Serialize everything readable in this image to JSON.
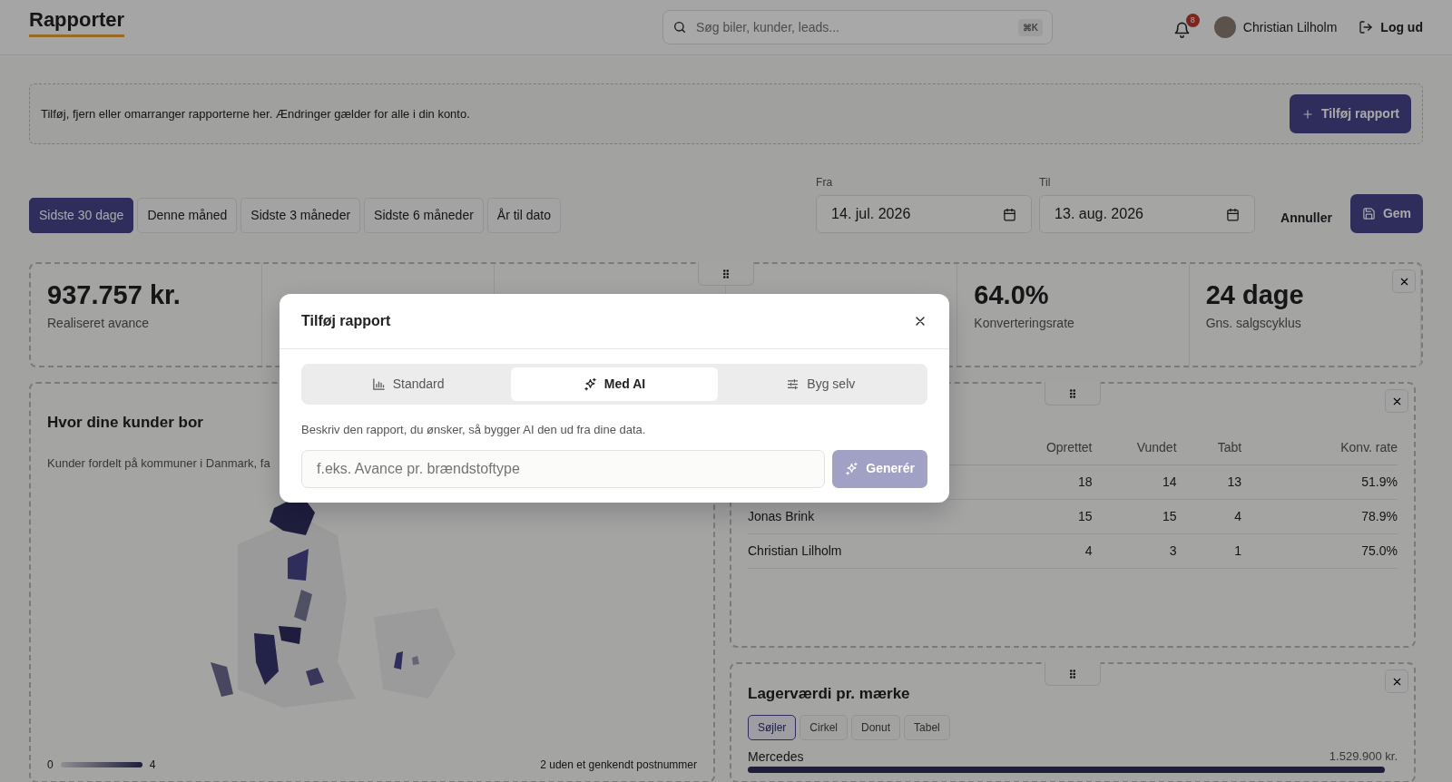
{
  "header": {
    "title": "Rapporter",
    "search": {
      "placeholder": "Søg biler, kunder, leads...",
      "shortcut": "⌘K"
    },
    "notifications": {
      "count": "8"
    },
    "user": {
      "name": "Christian Lilholm"
    },
    "logout": "Log ud"
  },
  "info_bar": {
    "text": "Tilføj, fjern eller omarranger rapporterne her. Ændringer gælder for alle i din konto.",
    "button": "Tilføj rapport"
  },
  "periods": [
    {
      "label": "Sidste 30 dage",
      "selected": true
    },
    {
      "label": "Denne måned",
      "selected": false
    },
    {
      "label": "Sidste 3 måneder",
      "selected": false
    },
    {
      "label": "Sidste 6 måneder",
      "selected": false
    },
    {
      "label": "År til dato",
      "selected": false
    }
  ],
  "date_range": {
    "from": {
      "label": "Fra",
      "value": "14. jul. 2026"
    },
    "to": {
      "label": "Til",
      "value": "13. aug. 2026"
    }
  },
  "actions": {
    "cancel": "Annuller",
    "save": "Gem"
  },
  "kpis": [
    {
      "value": "937.757 kr.",
      "label": "Realiseret avance"
    },
    {
      "value": "64.0%",
      "label": "Konverteringsrate"
    },
    {
      "value": "24 dage",
      "label": "Gns. salgscyklus"
    }
  ],
  "map_panel": {
    "title": "Hvor dine kunder bor",
    "subtitle": "Kunder fordelt på kommuner i Danmark, fa",
    "legend_min": "0",
    "legend_max": "4",
    "note": "2 uden et genkendt postnummer"
  },
  "table_panel": {
    "columns": [
      "Oprettet",
      "Vundet",
      "Tabt",
      "Konv. rate"
    ],
    "rows": [
      {
        "cells": [
          "18",
          "14",
          "13",
          "51.9%"
        ]
      },
      {
        "name": "Jonas Brink",
        "cells": [
          "15",
          "15",
          "4",
          "78.9%"
        ]
      },
      {
        "name": "Christian Lilholm",
        "cells": [
          "4",
          "3",
          "1",
          "75.0%"
        ]
      }
    ]
  },
  "stock_panel": {
    "title": "Lagerværdi pr. mærke",
    "views": [
      {
        "label": "Søjler",
        "selected": true
      },
      {
        "label": "Cirkel",
        "selected": false
      },
      {
        "label": "Donut",
        "selected": false
      },
      {
        "label": "Tabel",
        "selected": false
      }
    ],
    "bars": [
      {
        "label": "Mercedes",
        "value": "1.529.900 kr.",
        "level": 1.0
      }
    ]
  },
  "modal": {
    "title": "Tilføj rapport",
    "tabs": [
      {
        "label": "Standard",
        "kind": "standard",
        "selected": false
      },
      {
        "label": "Med AI",
        "kind": "ai",
        "selected": true
      },
      {
        "label": "Byg selv",
        "kind": "custom",
        "selected": false
      }
    ],
    "description": "Beskriv den rapport, du ønsker, så bygger AI den ud fra dine data.",
    "input": {
      "placeholder": "f.eks. Avance pr. brændstoftype"
    },
    "generate": {
      "label": "Generér",
      "disabled": true
    }
  }
}
